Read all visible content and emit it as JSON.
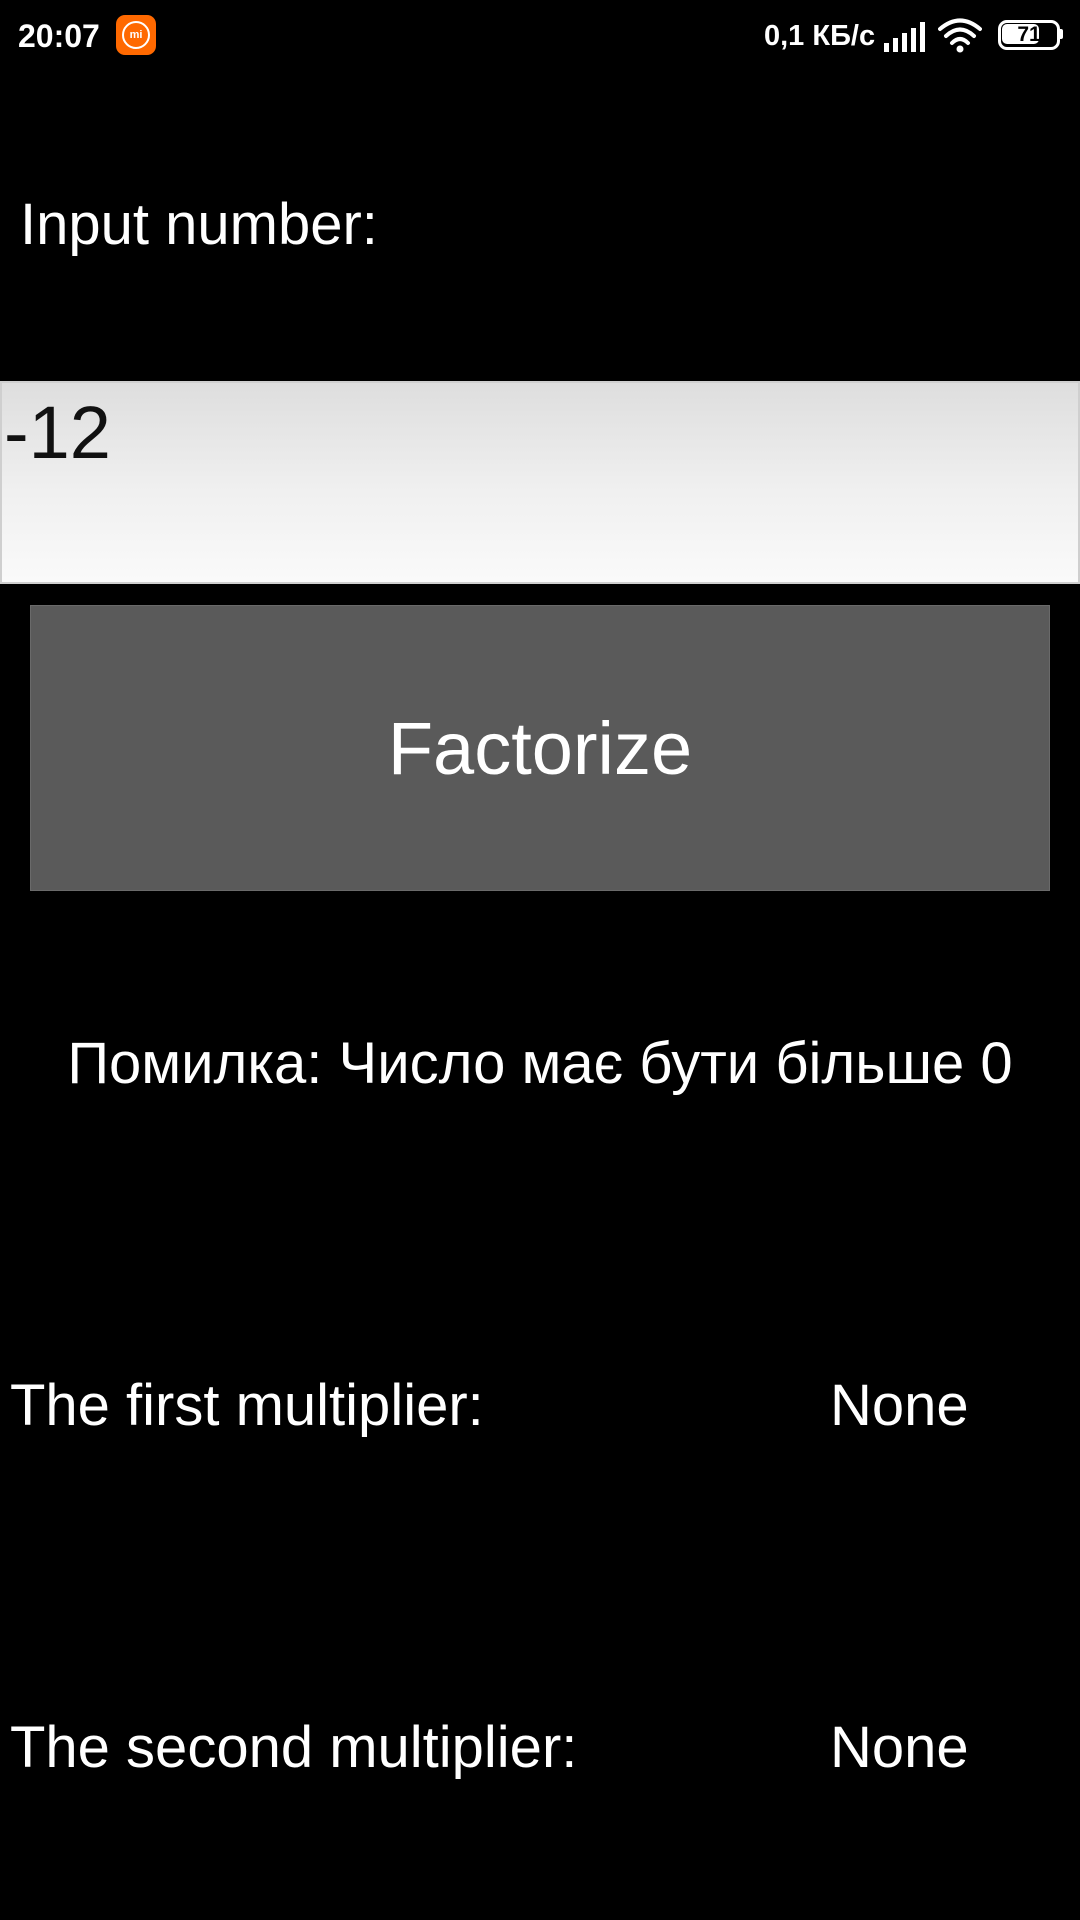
{
  "status_bar": {
    "time": "20:07",
    "app_icon": "mi-icon",
    "app_icon_text": "mi",
    "app_icon_color": "#ff6900",
    "network_speed": "0,1 КБ/с",
    "signal_icon": "signal-bars-icon",
    "wifi_icon": "wifi-icon",
    "battery_level": "71",
    "battery_fraction": 0.71
  },
  "form": {
    "input_label": "Input number:",
    "input_value": "-12",
    "factorize_label": "Factorize",
    "input_background": "#f0f0f0",
    "button_color": "#5a5a5a"
  },
  "result": {
    "error_message": "Помилка: Число має бути більше 0",
    "first_label": "The first multiplier:",
    "first_value": "None",
    "second_label": "The second multiplier:",
    "second_value": "None"
  }
}
